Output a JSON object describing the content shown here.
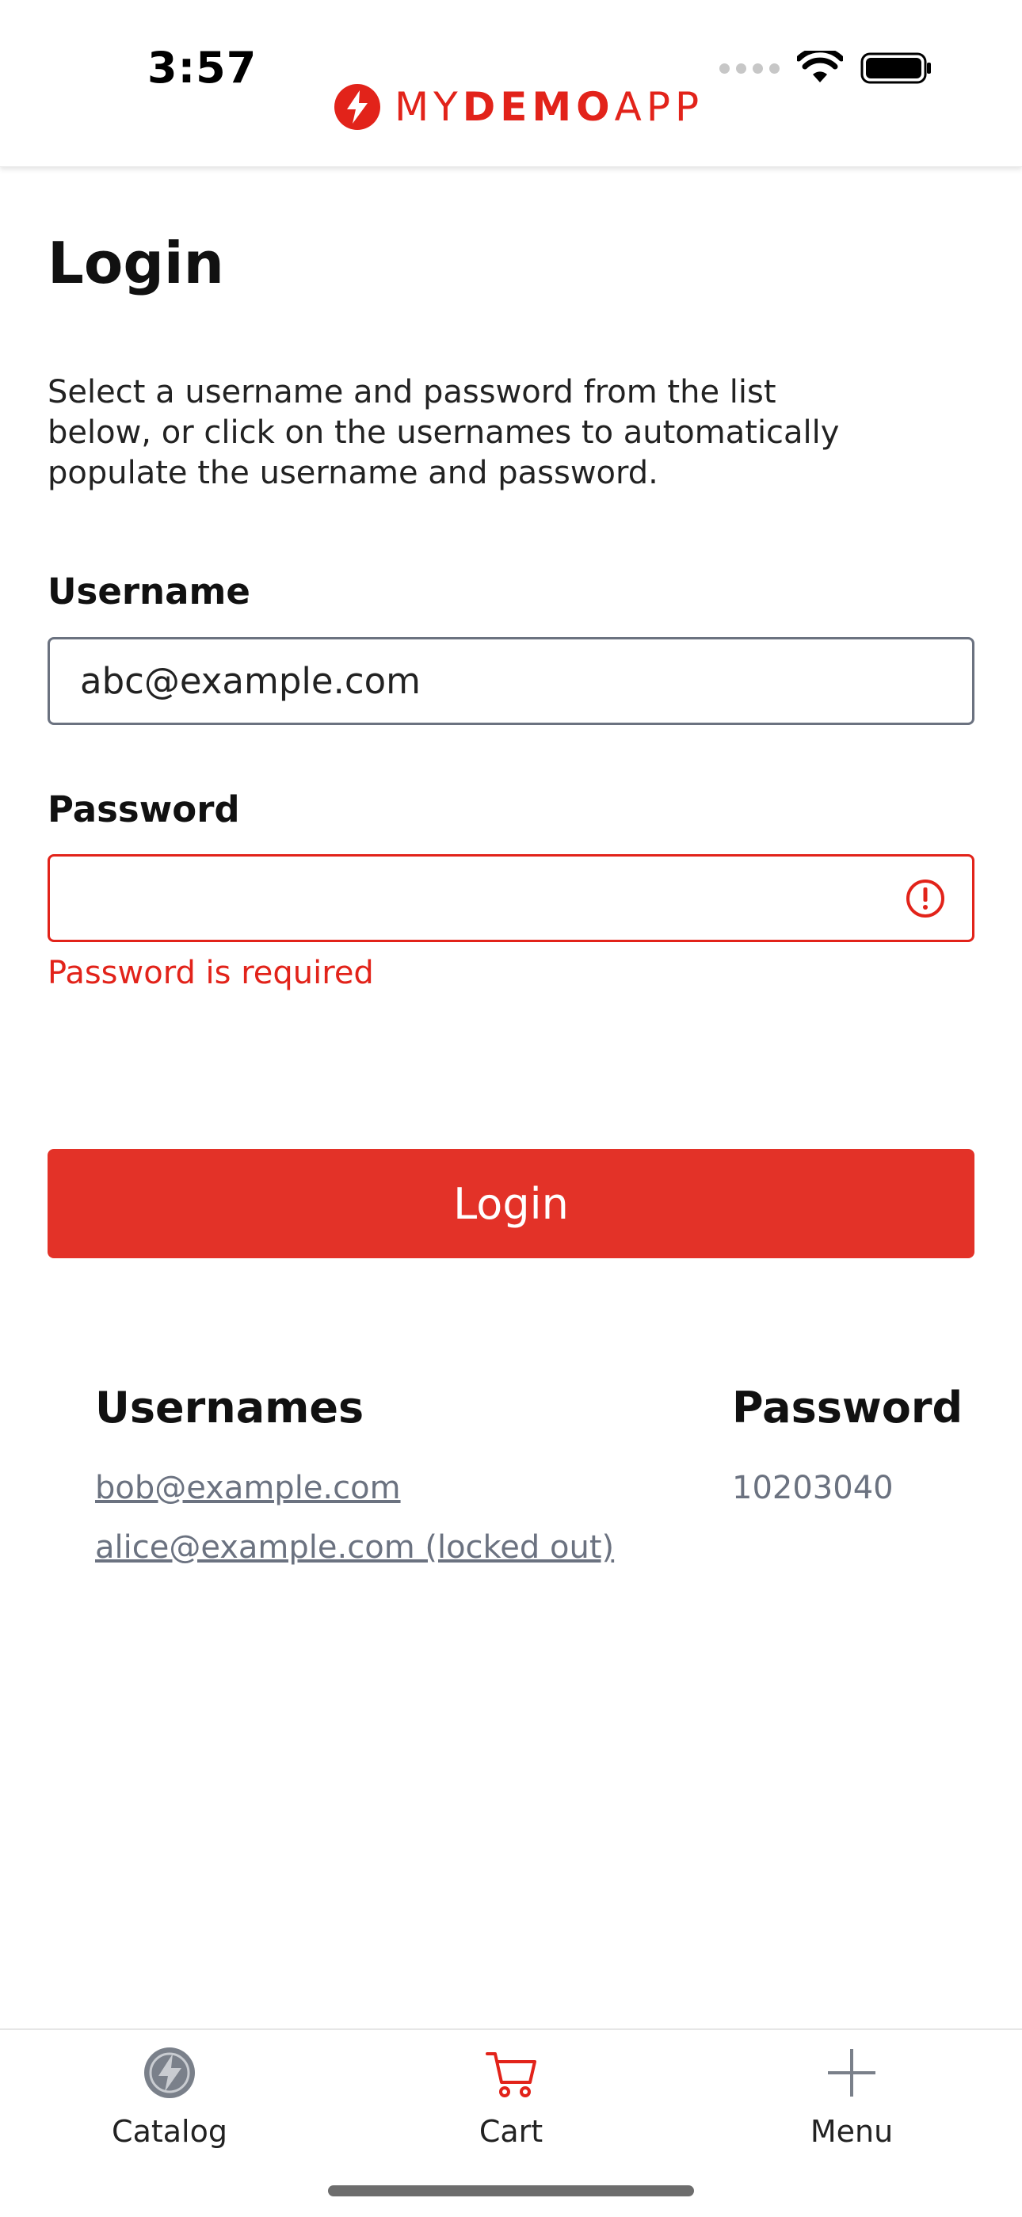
{
  "status_bar": {
    "time": "3:57"
  },
  "header": {
    "logo_prefix": "MY",
    "logo_bold": "DEMO",
    "logo_suffix": "APP",
    "brand_color": "#e2231a"
  },
  "login": {
    "title": "Login",
    "instructions": "Select a username and password from the list below, or click on the usernames to automatically populate the username and password.",
    "username_label": "Username",
    "username_value": "abc@example.com",
    "password_label": "Password",
    "password_value": "",
    "password_error": "Password is required",
    "login_button": "Login",
    "error_color": "#e2231a",
    "button_color": "#e33228"
  },
  "credentials": {
    "usernames_header": "Usernames",
    "password_header": "Password",
    "usernames": [
      "bob@example.com",
      "alice@example.com (locked out)"
    ],
    "password": "10203040"
  },
  "tabbar": {
    "tabs": [
      {
        "label": "Catalog",
        "icon": "catalog-logo-icon",
        "active": false
      },
      {
        "label": "Cart",
        "icon": "cart-icon",
        "active": true
      },
      {
        "label": "Menu",
        "icon": "plus-icon",
        "active": false
      }
    ]
  }
}
